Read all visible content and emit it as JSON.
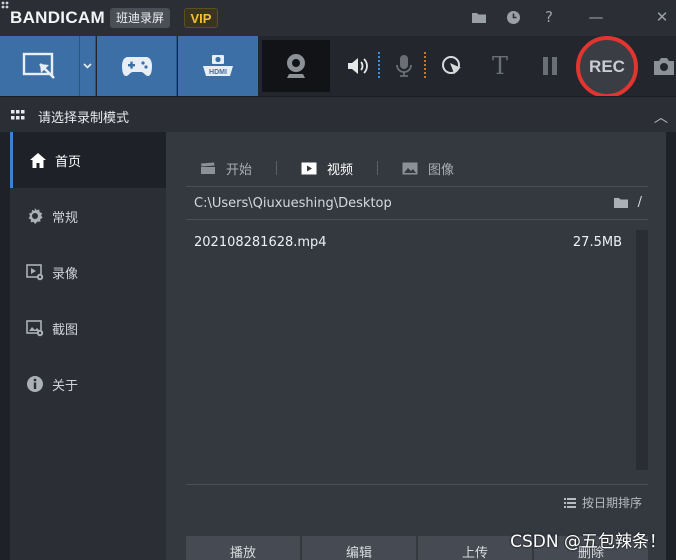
{
  "titlebar": {
    "brand_prefix": "BANDI",
    "brand_suffix": "CAM",
    "brand_cn": "班迪录屏",
    "vip": "VIP",
    "icons": [
      "folder-icon",
      "clock-icon",
      "help-icon",
      "minimize-icon",
      "close-icon"
    ],
    "help_glyph": "?",
    "minimize_glyph": "—",
    "close_glyph": "✕"
  },
  "toolbar": {
    "modes": [
      "screen-rect-mode",
      "game-mode",
      "hdmi-mode"
    ],
    "hdmi_label": "HDMI",
    "tools": [
      "webcam",
      "speaker",
      "microphone",
      "cursor-click",
      "text-overlay",
      "pause",
      "record",
      "screenshot"
    ],
    "text_tool_glyph": "T",
    "rec_label": "REC",
    "accent": "#3c6fa6",
    "rec_color": "#e2352f"
  },
  "modebar": {
    "label": "请选择录制模式",
    "collapse_glyph": "︿"
  },
  "sidebar": {
    "items": [
      {
        "label": "首页",
        "icon": "home-icon",
        "active": true
      },
      {
        "label": "常规",
        "icon": "gear-icon",
        "active": false
      },
      {
        "label": "录像",
        "icon": "video-settings-icon",
        "active": false
      },
      {
        "label": "截图",
        "icon": "image-settings-icon",
        "active": false
      },
      {
        "label": "关于",
        "icon": "info-icon",
        "active": false
      }
    ]
  },
  "content": {
    "tabs": [
      {
        "label": "开始",
        "icon": "clapper-icon",
        "active": false
      },
      {
        "label": "视频",
        "icon": "play-icon",
        "active": true
      },
      {
        "label": "图像",
        "icon": "picture-icon",
        "active": false
      }
    ],
    "path": "C:\\Users\\Qiuxueshing\\Desktop",
    "path_slash": "/",
    "files": [
      {
        "name": "202108281628.mp4",
        "size": "27.5MB"
      }
    ],
    "sort_label": "按日期排序",
    "actions": [
      "播放",
      "编辑",
      "上传",
      "删除"
    ]
  },
  "watermark": "CSDN @五包辣条！"
}
